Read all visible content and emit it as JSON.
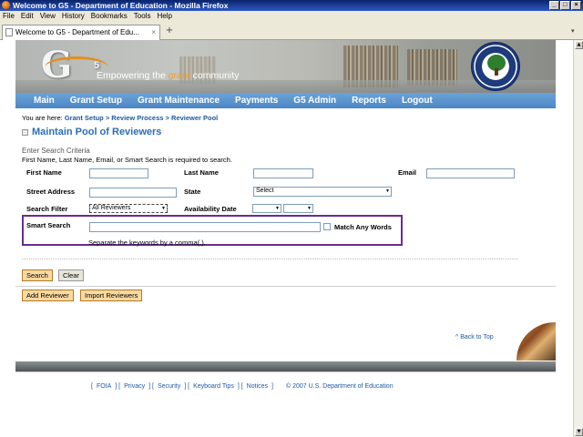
{
  "window": {
    "title": "Welcome to G5 - Department of Education - Mozilla Firefox"
  },
  "menu": [
    "File",
    "Edit",
    "View",
    "History",
    "Bookmarks",
    "Tools",
    "Help"
  ],
  "tab": {
    "label": "Welcome to G5 - Department of Edu..."
  },
  "banner": {
    "logo_text": "G",
    "logo_super": "5",
    "tagline_prefix": "Empowering the ",
    "tagline_accent": "grant",
    "tagline_suffix": " community"
  },
  "nav": [
    "Main",
    "Grant Setup",
    "Grant Maintenance",
    "Payments",
    "G5 Admin",
    "Reports",
    "Logout"
  ],
  "breadcrumb": {
    "prefix": "You are here: ",
    "path": "Grant Setup > Review Process > Reviewer Pool"
  },
  "page_title": "Maintain Pool of Reviewers",
  "search": {
    "heading": "Enter Search Criteria",
    "note": "First Name, Last Name, Email, or Smart Search is required to search.",
    "first_name_label": "First Name",
    "last_name_label": "Last Name",
    "email_label": "Email",
    "street_label": "Street Address",
    "state_label": "State",
    "state_value": "Select",
    "filter_label": "Search Filter",
    "filter_value": "All Reviewers",
    "availability_label": "Availability Date",
    "smart_label": "Smart Search",
    "match_label": "Match Any Words",
    "smart_hint": "Separate the keywords by a comma(,)."
  },
  "buttons": {
    "search": "Search",
    "clear": "Clear",
    "add_reviewer": "Add Reviewer",
    "import_reviewers": "Import Reviewers"
  },
  "back_to_top": "^ Back to Top",
  "footer": {
    "links": [
      "FOIA",
      "Privacy",
      "Security",
      "Keyboard Tips",
      "Notices"
    ],
    "copyright": "© 2007 U.S. Department of Education"
  }
}
